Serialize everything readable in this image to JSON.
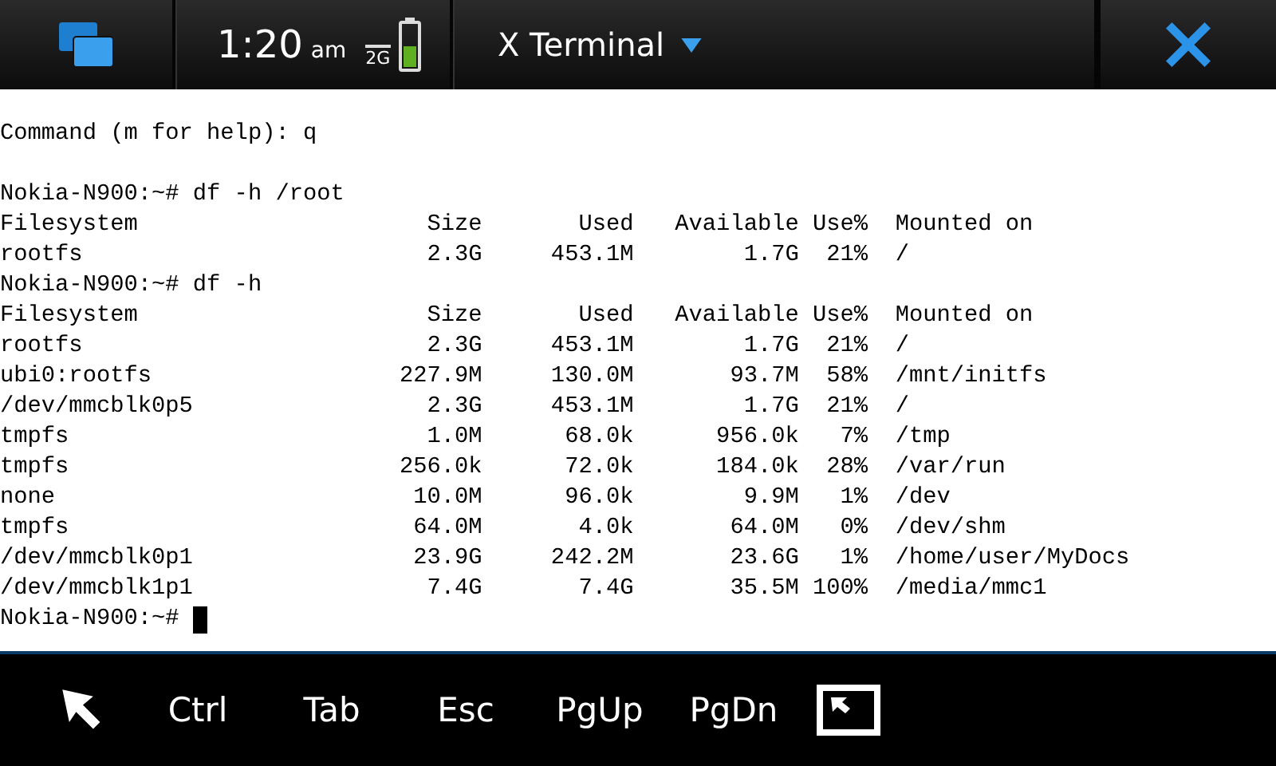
{
  "status_bar": {
    "time": "1:20",
    "ampm": "am",
    "network": "2G",
    "title": "X Terminal"
  },
  "terminal": {
    "lines": [
      {
        "kind": "text",
        "text": "Command (m for help): q"
      },
      {
        "kind": "blank"
      },
      {
        "kind": "text",
        "text": "Nokia-N900:~# df -h /root"
      },
      {
        "kind": "df",
        "cells": [
          "Filesystem",
          "Size",
          "Used",
          "Available",
          "Use%",
          "Mounted on"
        ]
      },
      {
        "kind": "df",
        "cells": [
          "rootfs",
          "2.3G",
          "453.1M",
          "1.7G",
          "21%",
          "/"
        ]
      },
      {
        "kind": "text",
        "text": "Nokia-N900:~# df -h"
      },
      {
        "kind": "df",
        "cells": [
          "Filesystem",
          "Size",
          "Used",
          "Available",
          "Use%",
          "Mounted on"
        ]
      },
      {
        "kind": "df",
        "cells": [
          "rootfs",
          "2.3G",
          "453.1M",
          "1.7G",
          "21%",
          "/"
        ]
      },
      {
        "kind": "df",
        "cells": [
          "ubi0:rootfs",
          "227.9M",
          "130.0M",
          "93.7M",
          "58%",
          "/mnt/initfs"
        ]
      },
      {
        "kind": "df",
        "cells": [
          "/dev/mmcblk0p5",
          "2.3G",
          "453.1M",
          "1.7G",
          "21%",
          "/"
        ]
      },
      {
        "kind": "df",
        "cells": [
          "tmpfs",
          "1.0M",
          "68.0k",
          "956.0k",
          "7%",
          "/tmp"
        ]
      },
      {
        "kind": "df",
        "cells": [
          "tmpfs",
          "256.0k",
          "72.0k",
          "184.0k",
          "28%",
          "/var/run"
        ]
      },
      {
        "kind": "df",
        "cells": [
          "none",
          "10.0M",
          "96.0k",
          "9.9M",
          "1%",
          "/dev"
        ]
      },
      {
        "kind": "df",
        "cells": [
          "tmpfs",
          "64.0M",
          "4.0k",
          "64.0M",
          "0%",
          "/dev/shm"
        ]
      },
      {
        "kind": "df",
        "cells": [
          "/dev/mmcblk0p1",
          "23.9G",
          "242.2M",
          "23.6G",
          "1%",
          "/home/user/MyDocs"
        ]
      },
      {
        "kind": "df",
        "cells": [
          "/dev/mmcblk1p1",
          "7.4G",
          "7.4G",
          "35.5M",
          "100%",
          "/media/mmc1"
        ]
      },
      {
        "kind": "prompt",
        "text": "Nokia-N900:~# ",
        "cursor": true
      }
    ]
  },
  "toolbar": [
    {
      "kind": "pointer"
    },
    {
      "kind": "key",
      "label": "Ctrl"
    },
    {
      "kind": "key",
      "label": "Tab"
    },
    {
      "kind": "key",
      "label": "Esc"
    },
    {
      "kind": "key",
      "label": "PgUp"
    },
    {
      "kind": "key",
      "label": "PgDn"
    },
    {
      "kind": "fullscreen"
    }
  ]
}
